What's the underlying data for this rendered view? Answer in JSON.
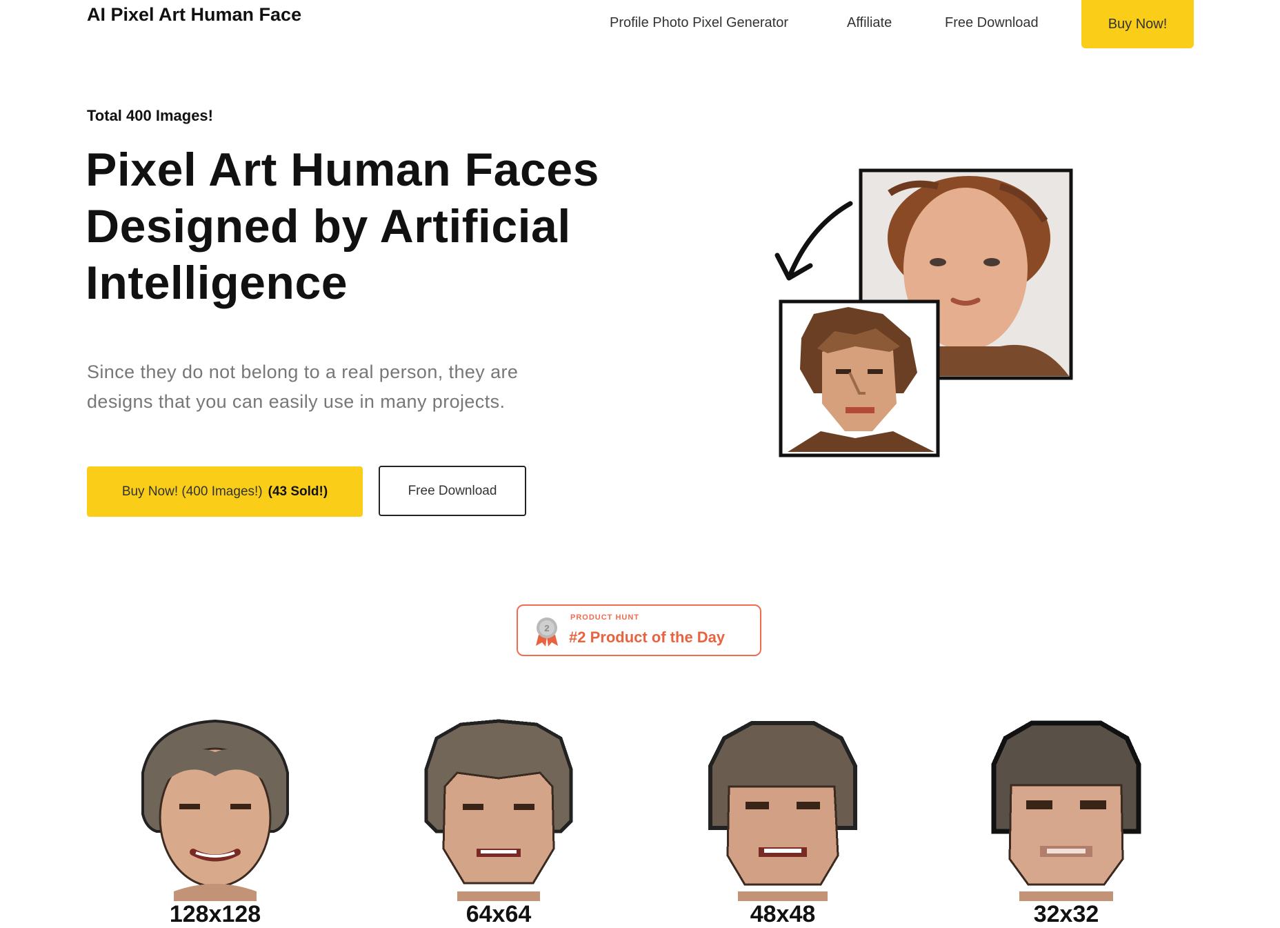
{
  "header": {
    "brand": "AI Pixel Art Human Face",
    "nav": [
      "Profile Photo Pixel Generator",
      "Affiliate",
      "Free Download"
    ],
    "buy_label": "Buy Now!"
  },
  "hero": {
    "eyebrow": "Total 400 Images!",
    "title": "Pixel Art Human Faces Designed by Artificial Intelligence",
    "subtitle": "Since they do not belong to a real person, they are designs that you can easily use in many projects.",
    "buy_button_main": "Buy Now! (400 Images!)",
    "buy_button_bold": "(43 Sold!)",
    "free_button": "Free Download"
  },
  "product_hunt": {
    "small_label": "PRODUCT HUNT",
    "badge_text": "#2 Product of the Day",
    "medal_number": "2"
  },
  "sizes": [
    "128x128",
    "64x64",
    "48x48",
    "32x32"
  ]
}
